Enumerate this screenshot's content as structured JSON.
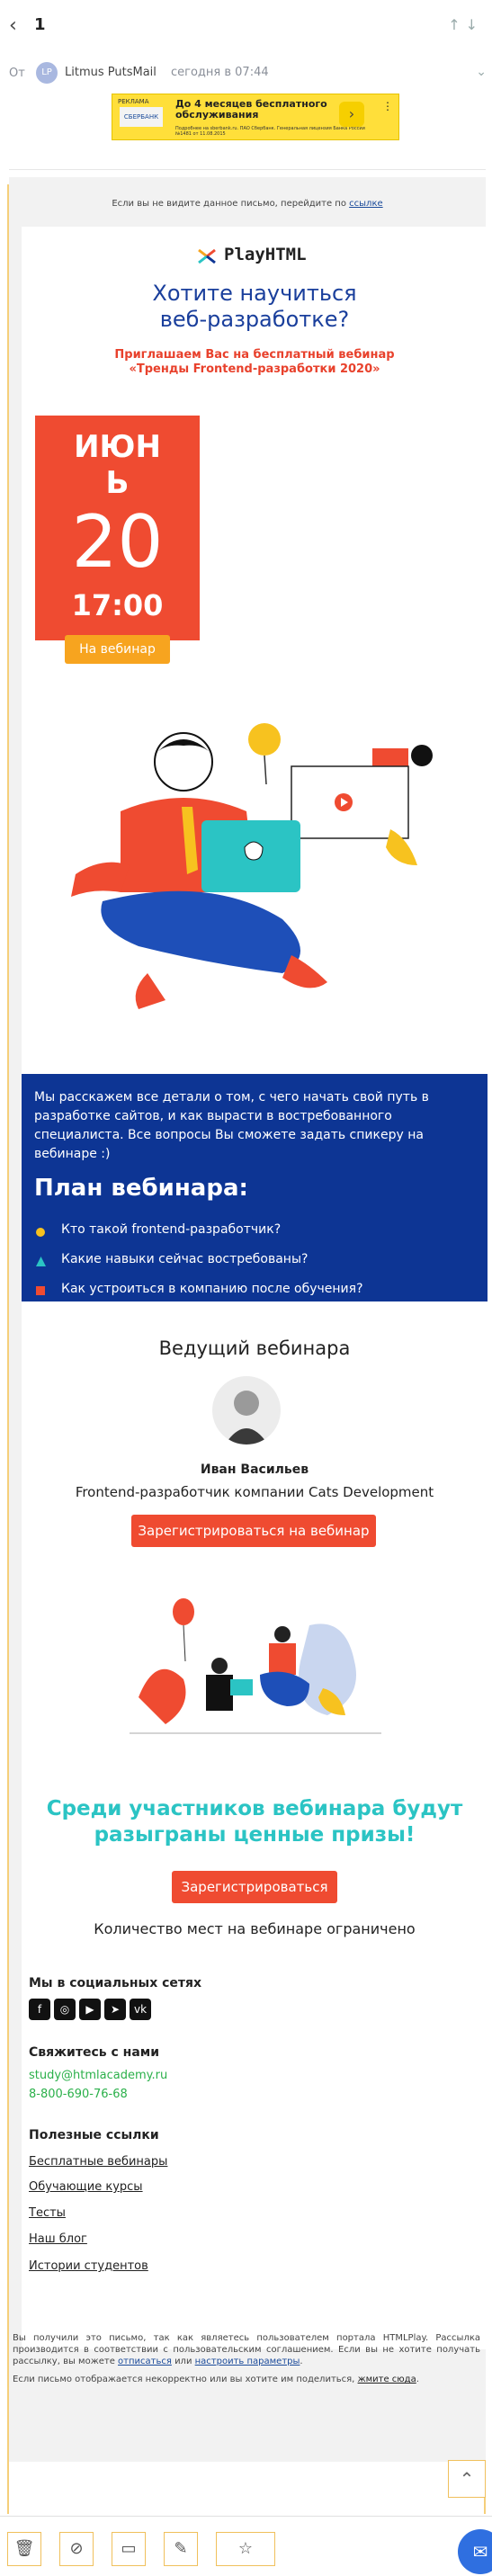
{
  "nav": {
    "back_icon": "chevron-left-icon",
    "count": "1"
  },
  "message": {
    "from_label": "От",
    "avatar_initials": "LP",
    "sender": "Litmus PutsMail",
    "sent_at": "сегодня в 07:44"
  },
  "ad": {
    "tag": "РЕКЛАМА",
    "logo_text": "СБЕРБАНК",
    "title": "До 4 месяцев бесплатного обслуживания",
    "subtitle": "Подробнее на sberbank.ru. ПАО Сбербанк. Генеральная лицензия Банка России №1481 от 11.08.2015"
  },
  "email": {
    "preview_note": "Если вы не видите данное письмо, перейдите по",
    "preview_link": "ссылке",
    "logo_text": "PlayHTML",
    "hero_title": "Хотите научиться веб-разработке?",
    "hero_subtitle": "Приглашаем Вас на бесплатный вебинар «Тренды Frontend-разработки 2020»",
    "date_month": "ИЮНЬ",
    "date_day": "20",
    "date_time": "17:00",
    "date_button": "На вебинар",
    "intro": "Мы расскажем все детали о том, с чего начать свой путь в разработке сайтов, и как вырасти в востребованного специалиста. Все вопросы Вы сможете задать спикеру на вебинаре :)",
    "plan_title": "План вебинара:",
    "plan_items": [
      "Кто такой frontend-разработчик?",
      "Какие навыки сейчас востребованы?",
      "Как устроиться в компанию после обучения?"
    ],
    "host_title": "Ведущий вебинара",
    "host_name": "Иван Васильев",
    "host_role": "Frontend-разработчик компании Cats Development",
    "register_button_1": "Зарегистрироваться на вебинар",
    "prizes": "Среди участников вебинара будут разыграны ценные призы!",
    "register_button_2": "Зарегистрироваться",
    "limited": "Количество мест на вебинаре ограничено",
    "social_title": "Мы в социальных сетях",
    "contact_title": "Свяжитесь с нами",
    "contact_email": "study@htmlacademy.ru",
    "contact_phone": "8-800-690-76-68",
    "links_title": "Полезные ссылки",
    "links": [
      "Бесплатные вебинары",
      "Обучающие курсы",
      "Тесты",
      "Наш блог",
      "Истории студентов"
    ],
    "legal_text": "Вы получили это письмо, так как являетесь пользователем портала HTMLPlay. Рассылка производится в соответствии с пользовательским соглашением. Если вы не хотите получать рассылку, вы можете",
    "legal_unsubscribe": "отписаться",
    "legal_or": "или",
    "legal_settings": "настроить параметры",
    "legal_note": "Если письмо отображается некорректно или вы хотите им поделиться,",
    "legal_note_link": "жмите сюда"
  },
  "toolbar": [
    "trash-icon",
    "block-icon",
    "folder-icon",
    "edit-icon",
    "star-icon"
  ],
  "colors": {
    "blue": "#0d3594",
    "red": "#ef4b31",
    "orange": "#f7a41f",
    "teal": "#2bc4c4"
  }
}
